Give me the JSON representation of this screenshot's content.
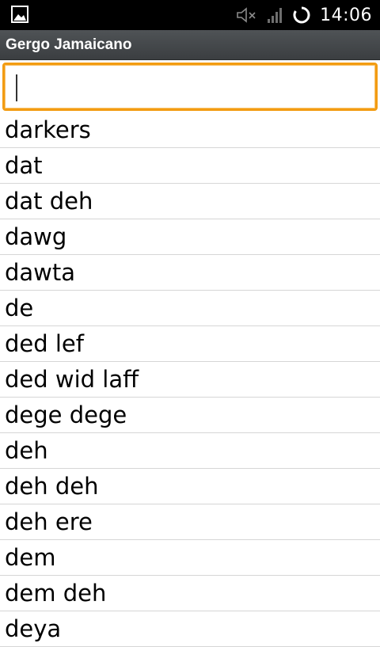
{
  "status_bar": {
    "time": "14:06",
    "icons": [
      "gallery-notification-icon",
      "mute-icon",
      "signal-icon",
      "sync-icon"
    ]
  },
  "app": {
    "title": "Gergo Jamaicano"
  },
  "search": {
    "value": "",
    "placeholder": "",
    "focus_color": "#f39c12"
  },
  "terms": [
    "darkers",
    "dat",
    "dat deh",
    "dawg",
    "dawta",
    "de",
    "ded lef",
    "ded wid laff",
    "dege dege",
    "deh",
    "deh deh",
    "deh ere",
    "dem",
    "dem deh",
    "deya"
  ]
}
